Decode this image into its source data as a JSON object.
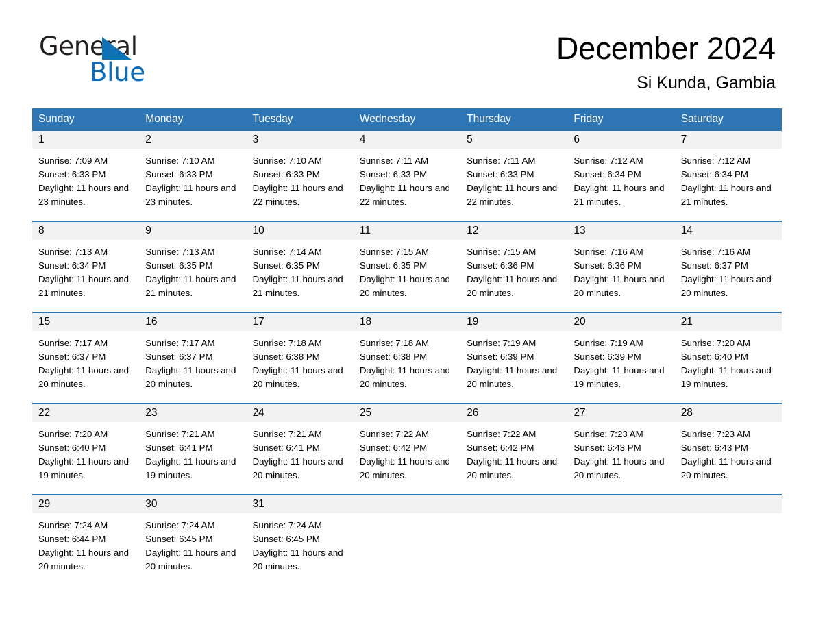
{
  "brand": {
    "name_part1": "General",
    "name_part2": "Blue"
  },
  "header": {
    "month_title": "December 2024",
    "location": "Si Kunda, Gambia"
  },
  "colors": {
    "header_blue": "#2e75b6",
    "brand_blue": "#0a6cbb",
    "day_band_gray": "#f2f2f2"
  },
  "calendar": {
    "weekdays": [
      "Sunday",
      "Monday",
      "Tuesday",
      "Wednesday",
      "Thursday",
      "Friday",
      "Saturday"
    ],
    "weeks": [
      [
        {
          "day": "1",
          "sunrise": "Sunrise: 7:09 AM",
          "sunset": "Sunset: 6:33 PM",
          "daylight": "Daylight: 11 hours and 23 minutes."
        },
        {
          "day": "2",
          "sunrise": "Sunrise: 7:10 AM",
          "sunset": "Sunset: 6:33 PM",
          "daylight": "Daylight: 11 hours and 23 minutes."
        },
        {
          "day": "3",
          "sunrise": "Sunrise: 7:10 AM",
          "sunset": "Sunset: 6:33 PM",
          "daylight": "Daylight: 11 hours and 22 minutes."
        },
        {
          "day": "4",
          "sunrise": "Sunrise: 7:11 AM",
          "sunset": "Sunset: 6:33 PM",
          "daylight": "Daylight: 11 hours and 22 minutes."
        },
        {
          "day": "5",
          "sunrise": "Sunrise: 7:11 AM",
          "sunset": "Sunset: 6:33 PM",
          "daylight": "Daylight: 11 hours and 22 minutes."
        },
        {
          "day": "6",
          "sunrise": "Sunrise: 7:12 AM",
          "sunset": "Sunset: 6:34 PM",
          "daylight": "Daylight: 11 hours and 21 minutes."
        },
        {
          "day": "7",
          "sunrise": "Sunrise: 7:12 AM",
          "sunset": "Sunset: 6:34 PM",
          "daylight": "Daylight: 11 hours and 21 minutes."
        }
      ],
      [
        {
          "day": "8",
          "sunrise": "Sunrise: 7:13 AM",
          "sunset": "Sunset: 6:34 PM",
          "daylight": "Daylight: 11 hours and 21 minutes."
        },
        {
          "day": "9",
          "sunrise": "Sunrise: 7:13 AM",
          "sunset": "Sunset: 6:35 PM",
          "daylight": "Daylight: 11 hours and 21 minutes."
        },
        {
          "day": "10",
          "sunrise": "Sunrise: 7:14 AM",
          "sunset": "Sunset: 6:35 PM",
          "daylight": "Daylight: 11 hours and 21 minutes."
        },
        {
          "day": "11",
          "sunrise": "Sunrise: 7:15 AM",
          "sunset": "Sunset: 6:35 PM",
          "daylight": "Daylight: 11 hours and 20 minutes."
        },
        {
          "day": "12",
          "sunrise": "Sunrise: 7:15 AM",
          "sunset": "Sunset: 6:36 PM",
          "daylight": "Daylight: 11 hours and 20 minutes."
        },
        {
          "day": "13",
          "sunrise": "Sunrise: 7:16 AM",
          "sunset": "Sunset: 6:36 PM",
          "daylight": "Daylight: 11 hours and 20 minutes."
        },
        {
          "day": "14",
          "sunrise": "Sunrise: 7:16 AM",
          "sunset": "Sunset: 6:37 PM",
          "daylight": "Daylight: 11 hours and 20 minutes."
        }
      ],
      [
        {
          "day": "15",
          "sunrise": "Sunrise: 7:17 AM",
          "sunset": "Sunset: 6:37 PM",
          "daylight": "Daylight: 11 hours and 20 minutes."
        },
        {
          "day": "16",
          "sunrise": "Sunrise: 7:17 AM",
          "sunset": "Sunset: 6:37 PM",
          "daylight": "Daylight: 11 hours and 20 minutes."
        },
        {
          "day": "17",
          "sunrise": "Sunrise: 7:18 AM",
          "sunset": "Sunset: 6:38 PM",
          "daylight": "Daylight: 11 hours and 20 minutes."
        },
        {
          "day": "18",
          "sunrise": "Sunrise: 7:18 AM",
          "sunset": "Sunset: 6:38 PM",
          "daylight": "Daylight: 11 hours and 20 minutes."
        },
        {
          "day": "19",
          "sunrise": "Sunrise: 7:19 AM",
          "sunset": "Sunset: 6:39 PM",
          "daylight": "Daylight: 11 hours and 20 minutes."
        },
        {
          "day": "20",
          "sunrise": "Sunrise: 7:19 AM",
          "sunset": "Sunset: 6:39 PM",
          "daylight": "Daylight: 11 hours and 19 minutes."
        },
        {
          "day": "21",
          "sunrise": "Sunrise: 7:20 AM",
          "sunset": "Sunset: 6:40 PM",
          "daylight": "Daylight: 11 hours and 19 minutes."
        }
      ],
      [
        {
          "day": "22",
          "sunrise": "Sunrise: 7:20 AM",
          "sunset": "Sunset: 6:40 PM",
          "daylight": "Daylight: 11 hours and 19 minutes."
        },
        {
          "day": "23",
          "sunrise": "Sunrise: 7:21 AM",
          "sunset": "Sunset: 6:41 PM",
          "daylight": "Daylight: 11 hours and 19 minutes."
        },
        {
          "day": "24",
          "sunrise": "Sunrise: 7:21 AM",
          "sunset": "Sunset: 6:41 PM",
          "daylight": "Daylight: 11 hours and 20 minutes."
        },
        {
          "day": "25",
          "sunrise": "Sunrise: 7:22 AM",
          "sunset": "Sunset: 6:42 PM",
          "daylight": "Daylight: 11 hours and 20 minutes."
        },
        {
          "day": "26",
          "sunrise": "Sunrise: 7:22 AM",
          "sunset": "Sunset: 6:42 PM",
          "daylight": "Daylight: 11 hours and 20 minutes."
        },
        {
          "day": "27",
          "sunrise": "Sunrise: 7:23 AM",
          "sunset": "Sunset: 6:43 PM",
          "daylight": "Daylight: 11 hours and 20 minutes."
        },
        {
          "day": "28",
          "sunrise": "Sunrise: 7:23 AM",
          "sunset": "Sunset: 6:43 PM",
          "daylight": "Daylight: 11 hours and 20 minutes."
        }
      ],
      [
        {
          "day": "29",
          "sunrise": "Sunrise: 7:24 AM",
          "sunset": "Sunset: 6:44 PM",
          "daylight": "Daylight: 11 hours and 20 minutes."
        },
        {
          "day": "30",
          "sunrise": "Sunrise: 7:24 AM",
          "sunset": "Sunset: 6:45 PM",
          "daylight": "Daylight: 11 hours and 20 minutes."
        },
        {
          "day": "31",
          "sunrise": "Sunrise: 7:24 AM",
          "sunset": "Sunset: 6:45 PM",
          "daylight": "Daylight: 11 hours and 20 minutes."
        },
        {
          "day": "",
          "sunrise": "",
          "sunset": "",
          "daylight": ""
        },
        {
          "day": "",
          "sunrise": "",
          "sunset": "",
          "daylight": ""
        },
        {
          "day": "",
          "sunrise": "",
          "sunset": "",
          "daylight": ""
        },
        {
          "day": "",
          "sunrise": "",
          "sunset": "",
          "daylight": ""
        }
      ]
    ]
  }
}
